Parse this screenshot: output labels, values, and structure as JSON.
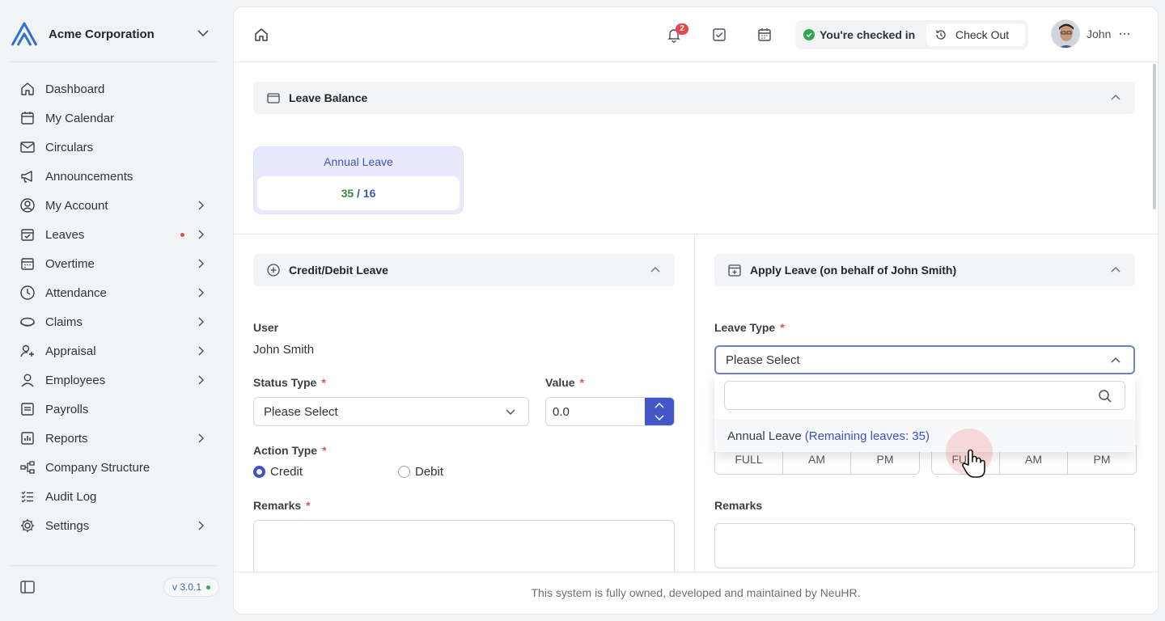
{
  "brand": {
    "name": "Acme Corporation",
    "accent": "#3f51c8"
  },
  "sidebar": {
    "items": [
      {
        "label": "Dashboard",
        "icon": "home-icon",
        "has_children": false
      },
      {
        "label": "My Calendar",
        "icon": "calendar-icon",
        "has_children": false
      },
      {
        "label": "Circulars",
        "icon": "mail-icon",
        "has_children": false
      },
      {
        "label": "Announcements",
        "icon": "megaphone-icon",
        "has_children": false
      },
      {
        "label": "My Account",
        "icon": "user-circle-icon",
        "has_children": true
      },
      {
        "label": "Leaves",
        "icon": "calendar-check-icon",
        "has_children": true,
        "notification_dot": true
      },
      {
        "label": "Overtime",
        "icon": "calendar-clock-icon",
        "has_children": true
      },
      {
        "label": "Attendance",
        "icon": "clock-icon",
        "has_children": true
      },
      {
        "label": "Claims",
        "icon": "coins-icon",
        "has_children": true
      },
      {
        "label": "Appraisal",
        "icon": "user-star-icon",
        "has_children": true
      },
      {
        "label": "Employees",
        "icon": "user-icon",
        "has_children": true
      },
      {
        "label": "Payrolls",
        "icon": "receipt-icon",
        "has_children": false
      },
      {
        "label": "Reports",
        "icon": "chart-icon",
        "has_children": true
      },
      {
        "label": "Company Structure",
        "icon": "org-chart-icon",
        "has_children": false
      },
      {
        "label": "Audit Log",
        "icon": "list-check-icon",
        "has_children": false
      },
      {
        "label": "Settings",
        "icon": "gear-icon",
        "has_children": true
      }
    ],
    "version": "v 3.0.1"
  },
  "topbar": {
    "notification_count": "2",
    "checkin_status": "You're checked in",
    "checkout_label": "Check Out",
    "user_name": "John"
  },
  "leave_balance": {
    "title": "Leave Balance",
    "card_title": "Annual Leave",
    "used": "35",
    "separator": "/",
    "total": "16"
  },
  "credit_debit": {
    "title": "Credit/Debit Leave",
    "user_label": "User",
    "user_value": "John Smith",
    "status_type_label": "Status Type",
    "status_type_value": "Please Select",
    "value_label": "Value",
    "value": "0.0",
    "action_type_label": "Action Type",
    "action_options": [
      "Credit",
      "Debit"
    ],
    "action_selected": "Credit",
    "remarks_label": "Remarks",
    "required_mark": "*"
  },
  "apply_leave": {
    "title": "Apply Leave (on behalf of John Smith)",
    "leave_type_label": "Leave Type",
    "leave_type_value": "Please Select",
    "dropdown_option": "Annual Leave",
    "dropdown_option_remaining": "(Remaining leaves: 35)",
    "segment_start": [
      "FULL",
      "AM",
      "PM"
    ],
    "segment_end": [
      "FULL",
      "AM",
      "PM"
    ],
    "remarks_label": "Remarks"
  },
  "footer": {
    "text": "This system is fully owned, developed and maintained by NeuHR."
  }
}
